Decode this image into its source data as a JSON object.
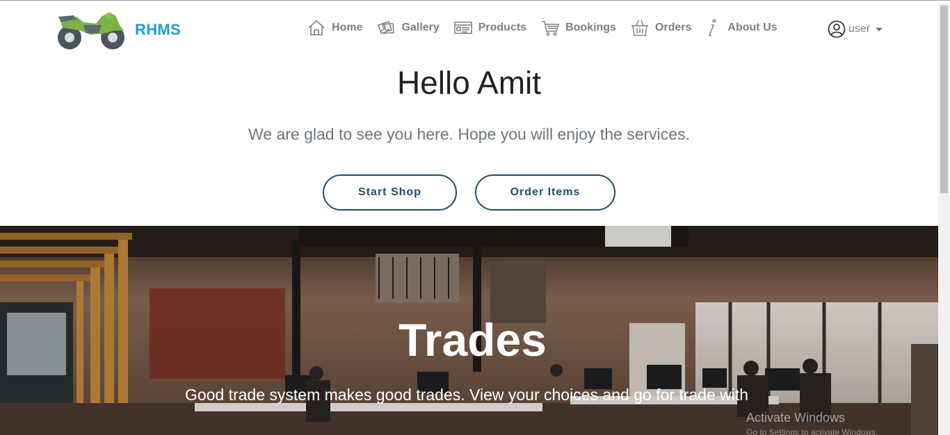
{
  "brand": {
    "name": "RHMS",
    "logo_icon": "motorcycle-icon",
    "accent": "#1f9bd0"
  },
  "nav": {
    "items": [
      {
        "label": "Home",
        "icon": "home-icon"
      },
      {
        "label": "Gallery",
        "icon": "gallery-icon"
      },
      {
        "label": "Products",
        "icon": "products-icon"
      },
      {
        "label": "Bookings",
        "icon": "cart-icon"
      },
      {
        "label": "Orders",
        "icon": "basket-icon"
      },
      {
        "label": "About Us",
        "icon": "info-icon"
      }
    ],
    "user": {
      "label": "user",
      "icon": "user-icon"
    }
  },
  "hero": {
    "title": "Hello Amit",
    "subtitle": "We are glad to see you here. Hope you will enjoy the services.",
    "buttons": {
      "start": "Start Shop",
      "order": "Order Items"
    },
    "button_color": "#1d4e66"
  },
  "banner": {
    "title": "Trades",
    "subtitle": "Good trade system makes good trades. View your choices and go for trade with",
    "watermark": "Activate Windows",
    "watermark_sub": "Go to Settings to activate Windows."
  }
}
